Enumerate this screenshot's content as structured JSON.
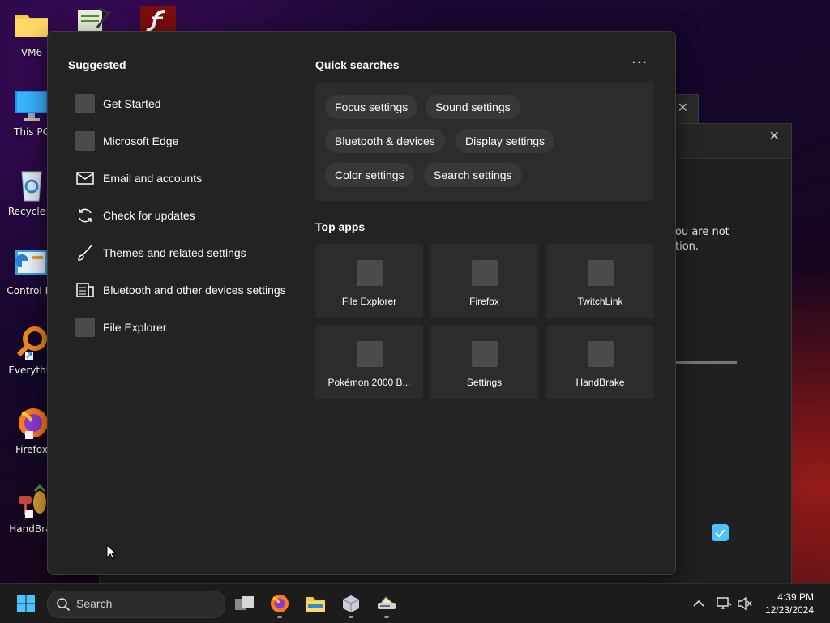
{
  "desktop": {
    "icons": [
      {
        "label": "VM6",
        "icon": "folder-icon"
      },
      {
        "label": "This PC",
        "icon": "monitor-icon"
      },
      {
        "label": "Recycle B",
        "icon": "recycle-bin-icon"
      },
      {
        "label": "Control Pa",
        "icon": "control-panel-icon"
      },
      {
        "label": "Everythin",
        "icon": "everything-search-icon"
      },
      {
        "label": "Firefox",
        "icon": "firefox-icon"
      },
      {
        "label": "HandBral",
        "icon": "handbrake-icon"
      }
    ]
  },
  "background_window": {
    "text_line1": "ou are not",
    "text_line2": "tion."
  },
  "search_panel": {
    "suggested_title": "Suggested",
    "suggested": [
      {
        "label": "Get Started",
        "icon": "app-placeholder-icon"
      },
      {
        "label": "Microsoft Edge",
        "icon": "app-placeholder-icon"
      },
      {
        "label": "Email and accounts",
        "icon": "mail-icon"
      },
      {
        "label": "Check for updates",
        "icon": "sync-icon"
      },
      {
        "label": "Themes and related settings",
        "icon": "brush-icon"
      },
      {
        "label": "Bluetooth and other devices settings",
        "icon": "devices-icon"
      },
      {
        "label": "File Explorer",
        "icon": "app-placeholder-icon"
      }
    ],
    "quick_searches_title": "Quick searches",
    "more_label": "···",
    "quick_searches": [
      "Focus settings",
      "Sound settings",
      "Bluetooth & devices",
      "Display settings",
      "Color settings",
      "Search settings"
    ],
    "top_apps_title": "Top apps",
    "top_apps": [
      "File Explorer",
      "Firefox",
      "TwitchLink",
      "Pokémon 2000 B...",
      "Settings",
      "HandBrake"
    ]
  },
  "taskbar": {
    "search_placeholder": "Search",
    "time": "4:39 PM",
    "date": "12/23/2024"
  },
  "colors": {
    "panel_bg": "#232323",
    "chip_bg": "#383838",
    "accent": "#4cc2ff"
  }
}
